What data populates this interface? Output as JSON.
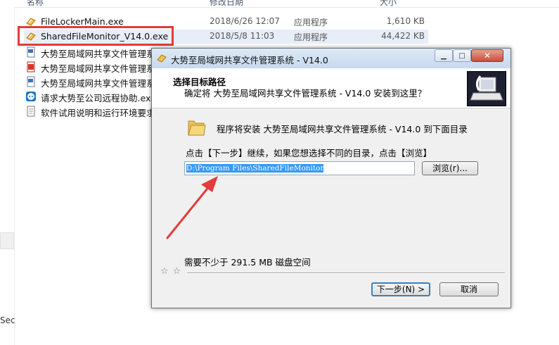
{
  "explorer": {
    "columns": {
      "name": "名称",
      "date": "修改日期",
      "size": "大小"
    },
    "left_cut_text": "Sec",
    "files": [
      {
        "name": "FileLockerMain.exe",
        "date": "2018/6/26 12:07",
        "type": "应用程序",
        "size": "1,610 KB",
        "icon": "exe-icon"
      },
      {
        "name": "SharedFileMonitor_V14.0.exe",
        "date": "2018/5/8 11:03",
        "type": "应用程序",
        "size": "44,422 KB",
        "icon": "exe-icon"
      },
      {
        "name": "大势至局域网共享文件管理系",
        "icon": "doc-icon"
      },
      {
        "name": "大势至局域网共享文件管理系",
        "icon": "pdf-icon"
      },
      {
        "name": "大势至局域网共享文件管理系",
        "icon": "doc-icon"
      },
      {
        "name": "请求大势至公司远程协助.exe",
        "icon": "teamviewer-icon"
      },
      {
        "name": "软件试用说明和运行环境要求",
        "icon": "txt-icon"
      }
    ]
  },
  "dialog": {
    "title": "大势至局域网共享文件管理系统 - V14.0",
    "heading": "选择目标路径",
    "subheading": "确定将 大势至局域网共享文件管理系统 - V14.0 安装到这里？",
    "info": "程序将安装 大势至局域网共享文件管理系统 - V14.0 到下面目录",
    "instruction": "点击【下一步】继续，如果您想选择不同的目录，点击【浏览】",
    "path": "D:\\Program Files\\SharedFileMonitor",
    "browse_label": "浏览(r)...",
    "space_required": "需要不少于 291.5 MB 磁盘空间",
    "stars": "☆☆",
    "next_label": "下一步(N) >",
    "cancel_label": "取消"
  },
  "colors": {
    "highlight": "#e43b3b",
    "arrow": "#e43b3b",
    "selection": "#3399ff"
  }
}
